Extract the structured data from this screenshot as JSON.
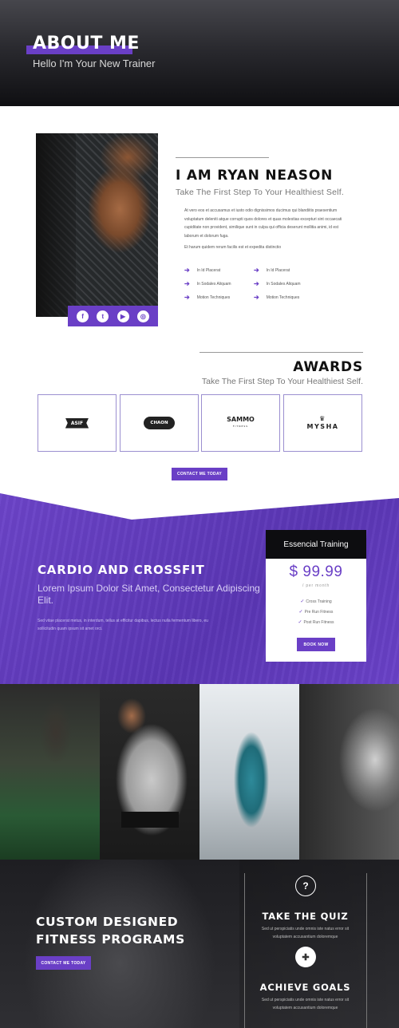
{
  "hero": {
    "title": "ABOUT ME",
    "subtitle": "Hello I'm Your New Trainer"
  },
  "about": {
    "name": "I AM RYAN NEASON",
    "tagline": "Take The First Step To Your Healthiest Self.",
    "paragraph1": "At vero eos et accusamus et iusto odio dignissimos ducimus qui blandiitis praesentium voluptatum deleniti atque corrupti quos dolores et quas molestias excepturi sint occaecati cupiditate non provident, similique sunt in culpa qui officia deserunt mollitia animi, id est laborum et dolorum fuga.",
    "paragraph2": "Et harum quidem rerum facilis est et expedita distinctio",
    "features": [
      "In Id Placerat",
      "In Sodales Aliquam",
      "Motion Techniques",
      "In Id Placerat",
      "In Sodales Aliquam",
      "Motion Techniques"
    ],
    "social_icons": [
      "facebook-icon",
      "twitter-icon",
      "youtube-icon",
      "instagram-icon"
    ],
    "social_glyphs": [
      "f",
      "t",
      "▶",
      "◎"
    ]
  },
  "awards": {
    "title": "AWARDS",
    "subtitle": "Take The First Step To Your Healthiest Self.",
    "logos": [
      {
        "text": "ASIF"
      },
      {
        "text": "CHAON"
      },
      {
        "text": "SAMMO",
        "small": "FITNESS"
      },
      {
        "crown": "♛",
        "text": "MYSHA"
      }
    ],
    "contact_button": "CONTACT ME TODAY"
  },
  "cardio": {
    "title": "CARDIO AND CROSSFIT",
    "subtitle": "Lorem Ipsum Dolor Sit Amet, Consectetur Adipiscing Elit.",
    "paragraph": "Sed vitae placerat metus, in interdum, tellus at efficitur dapibus, lectus nulla fermentum libero, eu sollicitudin quam ipsum sit amet orci."
  },
  "pricing": {
    "title": "Essencial Training",
    "price": "$ 99.99",
    "period": "/ per month",
    "items": [
      "Cross Training",
      "Pre Run Fitness",
      "Post Run Fitness"
    ],
    "button": "BOOK NOW"
  },
  "programs": {
    "title": "CUSTOM DESIGNED FITNESS PROGRAMS",
    "button": "CONTACT ME TODAY",
    "quiz_icon": "question-icon",
    "quiz_glyph": "?",
    "quiz_title": "TAKE THE QUIZ",
    "quiz_desc": "Sed ut perspiciatis unde omnis iste natus error sit voluptatem accusantium doloremque",
    "goals_icon": "puzzle-icon",
    "goals_glyph": "✚",
    "goals_title": "ACHIEVE GOALS",
    "goals_desc": "Sed ut perspiciatis unde omnis iste natus error sit voluptatem accusantium doloremque"
  },
  "colors": {
    "accent": "#6a3fc6",
    "dark": "#0d0d10"
  }
}
